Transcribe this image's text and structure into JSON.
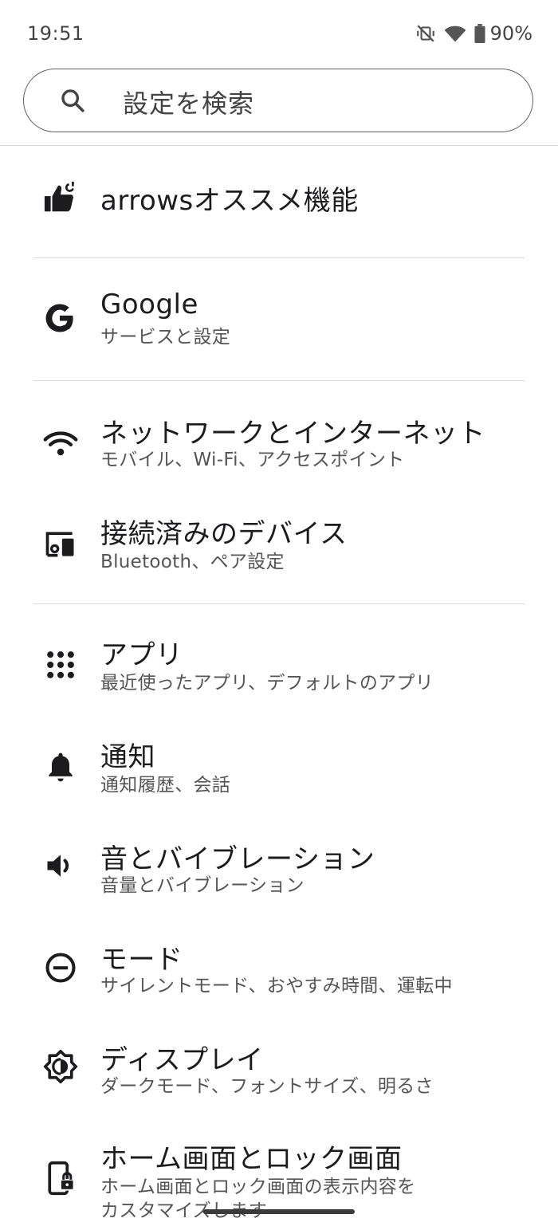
{
  "status": {
    "time": "19:51",
    "battery_label": "90%"
  },
  "search": {
    "placeholder": "設定を検索"
  },
  "settings": [
    {
      "title": "arrowsオススメ機能",
      "icon": "thumbs-up-icon"
    },
    {
      "title": "Google",
      "subtitle": "サービスと設定",
      "icon": "google-icon"
    },
    {
      "title": "ネットワークとインターネット",
      "subtitle": "モバイル、Wi-Fi、アクセスポイント",
      "icon": "wifi-icon"
    },
    {
      "title": "接続済みのデバイス",
      "subtitle": "Bluetooth、ペア設定",
      "icon": "devices-icon"
    },
    {
      "title": "アプリ",
      "subtitle": "最近使ったアプリ、デフォルトのアプリ",
      "icon": "apps-grid-icon"
    },
    {
      "title": "通知",
      "subtitle": "通知履歴、会話",
      "icon": "bell-icon"
    },
    {
      "title": "音とバイブレーション",
      "subtitle": "音量とバイブレーション",
      "icon": "volume-icon"
    },
    {
      "title": "モード",
      "subtitle": "サイレントモード、おやすみ時間、運転中",
      "icon": "do-not-disturb-icon"
    },
    {
      "title": "ディスプレイ",
      "subtitle": "ダークモード、フォントサイズ、明るさ",
      "icon": "brightness-icon"
    },
    {
      "title": "ホーム画面とロック画面",
      "subtitle_line1": "ホーム画面とロック画面の表示内容を",
      "subtitle_line2": "カスタマイズします",
      "icon": "phone-lock-icon"
    }
  ],
  "colors": {
    "text": "#1c1c1e",
    "subtext": "#555555",
    "divider": "#d9d9d9"
  }
}
